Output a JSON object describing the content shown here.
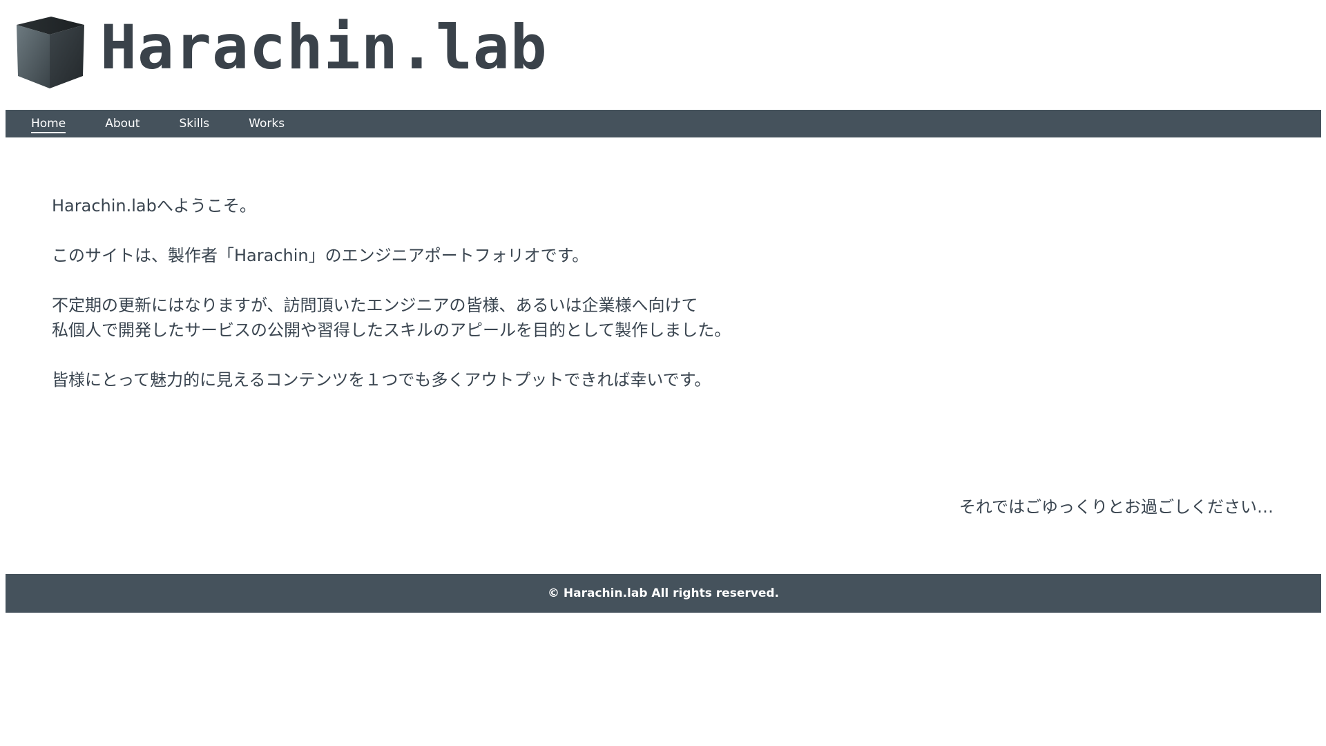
{
  "site": {
    "logo_text": "Harachin.lab",
    "logo_icon": "cube-icon"
  },
  "nav": {
    "items": [
      {
        "label": "Home",
        "active": true
      },
      {
        "label": "About",
        "active": false
      },
      {
        "label": "Skills",
        "active": false
      },
      {
        "label": "Works",
        "active": false
      }
    ]
  },
  "main": {
    "paragraphs": [
      "Harachin.labへようこそ。",
      "このサイトは、製作者「Harachin」のエンジニアポートフォリオです。",
      "不定期の更新にはなりますが、訪問頂いたエンジニアの皆様、あるいは企業様へ向けて\n私個人で開発したサービスの公開や習得したスキルのアピールを目的として製作しました。",
      "皆様にとって魅力的に見えるコンテンツを１つでも多くアウトプットできれば幸いです。"
    ],
    "closing": "それではごゆっくりとお過ごしください…"
  },
  "footer": {
    "copyright": "© Harachin.lab All rights reserved."
  },
  "colors": {
    "nav_bg": "#45525c",
    "footer_bg": "#45525c",
    "text": "#3a4550",
    "logo_text": "#3a424a"
  }
}
